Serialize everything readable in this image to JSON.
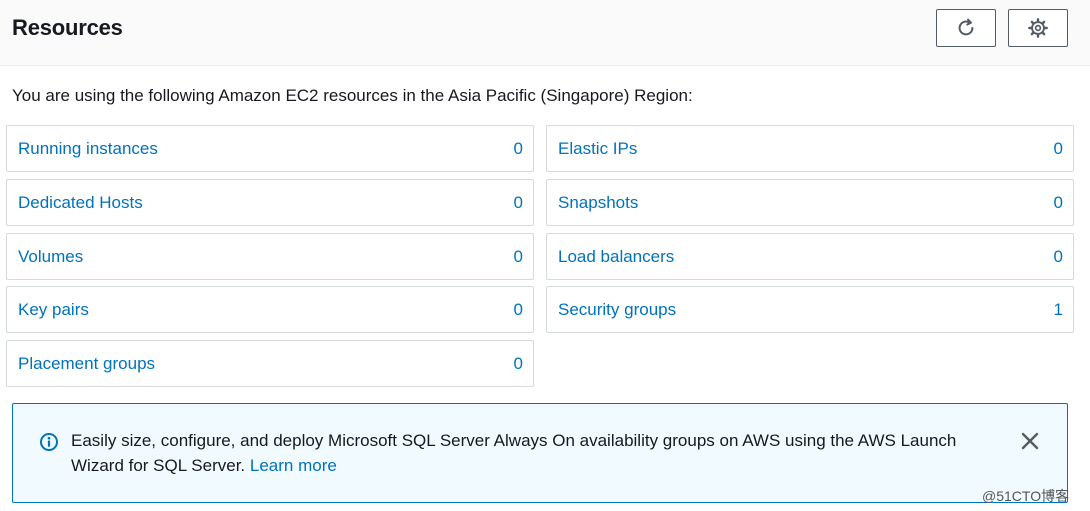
{
  "header": {
    "title": "Resources",
    "refresh_icon": "refresh-icon",
    "settings_icon": "gear-icon"
  },
  "intro": "You are using the following Amazon EC2 resources in the Asia Pacific (Singapore) Region:",
  "resources": {
    "left": [
      {
        "label": "Running instances",
        "count": "0"
      },
      {
        "label": "Dedicated Hosts",
        "count": "0"
      },
      {
        "label": "Volumes",
        "count": "0"
      },
      {
        "label": "Key pairs",
        "count": "0"
      },
      {
        "label": "Placement groups",
        "count": "0"
      }
    ],
    "right": [
      {
        "label": "Elastic IPs",
        "count": "0"
      },
      {
        "label": "Snapshots",
        "count": "0"
      },
      {
        "label": "Load balancers",
        "count": "0"
      },
      {
        "label": "Security groups",
        "count": "1"
      }
    ]
  },
  "banner": {
    "message": "Easily size, configure, and deploy Microsoft SQL Server Always On availability groups on AWS using the AWS Launch Wizard for SQL Server.",
    "link": "Learn more",
    "info_icon": "info-icon",
    "close_icon": "close-icon"
  },
  "watermark": "@51CTO博客",
  "colors": {
    "link": "#0073bb",
    "border": "#d5dbdb",
    "banner_bg": "#f1faff",
    "text": "#16191f"
  }
}
